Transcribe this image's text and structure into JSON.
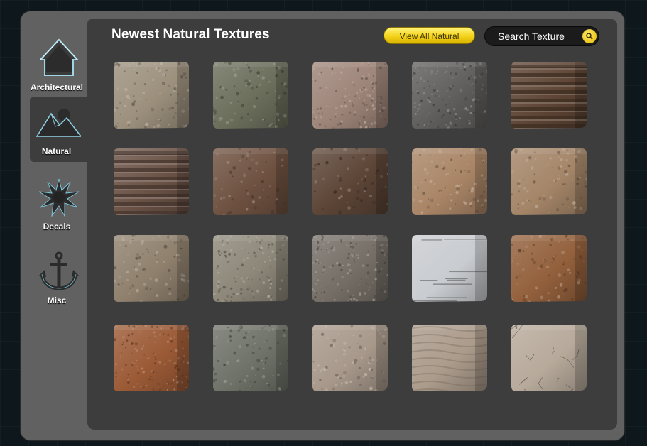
{
  "sidebar": {
    "categories": [
      {
        "label": "Architectural",
        "icon": "house-icon",
        "active": false
      },
      {
        "label": "Natural",
        "icon": "mountain-icon",
        "active": true
      },
      {
        "label": "Decals",
        "icon": "splat-icon",
        "active": false
      },
      {
        "label": "Misc",
        "icon": "anchor-icon",
        "active": false
      }
    ]
  },
  "main": {
    "title": "Newest Natural Textures",
    "view_all_label": "View All Natural",
    "search": {
      "placeholder": "Search Texture",
      "value": "",
      "icon": "search-icon"
    }
  },
  "textures": [
    {
      "name": "sand-stone-texture",
      "base": "#9c907d",
      "pattern": "rough"
    },
    {
      "name": "mossy-stone-texture",
      "base": "#6b6e5b",
      "pattern": "rough"
    },
    {
      "name": "pink-granite-texture",
      "base": "#9d8478",
      "pattern": "speckle"
    },
    {
      "name": "dark-granite-texture",
      "base": "#605e5c",
      "pattern": "speckle"
    },
    {
      "name": "layered-earth-texture",
      "base": "#5e4535",
      "pattern": "layers"
    },
    {
      "name": "striped-clay-texture",
      "base": "#6a5246",
      "pattern": "layers"
    },
    {
      "name": "brown-soil-texture",
      "base": "#6e5140",
      "pattern": "pitted"
    },
    {
      "name": "dark-soil-texture",
      "base": "#5b4436",
      "pattern": "pitted"
    },
    {
      "name": "tan-sand-texture",
      "base": "#a98566",
      "pattern": "rough"
    },
    {
      "name": "dry-dirt-texture",
      "base": "#a48568",
      "pattern": "rough"
    },
    {
      "name": "beige-stone-texture",
      "base": "#8f806d",
      "pattern": "rough"
    },
    {
      "name": "grey-gravel-texture",
      "base": "#8d8779",
      "pattern": "speckle"
    },
    {
      "name": "pebble-rock-texture",
      "base": "#756e66",
      "pattern": "speckle"
    },
    {
      "name": "white-birch-texture",
      "base": "#c9ccd0",
      "pattern": "bark"
    },
    {
      "name": "rust-rock-texture",
      "base": "#93603c",
      "pattern": "rough"
    },
    {
      "name": "red-granite-texture",
      "base": "#9b5a36",
      "pattern": "speckle"
    },
    {
      "name": "slate-grey-texture",
      "base": "#6f7268",
      "pattern": "rough"
    },
    {
      "name": "smooth-sand-texture",
      "base": "#a7988a",
      "pattern": "rough"
    },
    {
      "name": "wavy-sand-texture",
      "base": "#ab9b8b",
      "pattern": "waves"
    },
    {
      "name": "cracked-mud-texture",
      "base": "#b7aa9b",
      "pattern": "cracks"
    }
  ]
}
